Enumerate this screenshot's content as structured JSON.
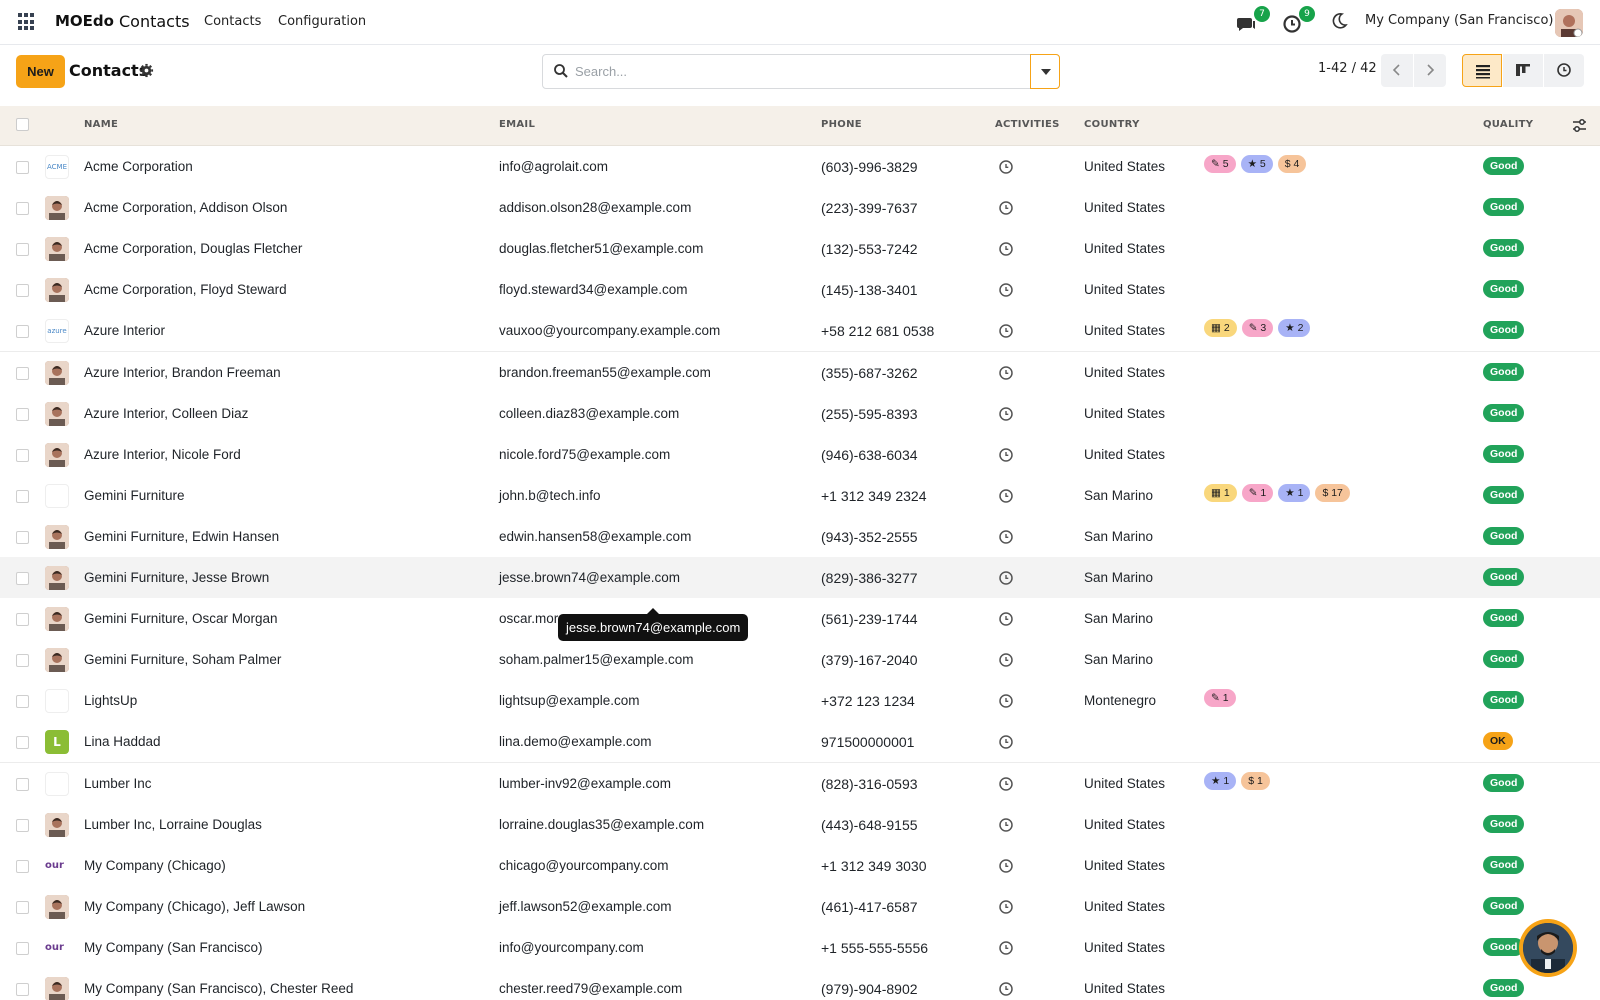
{
  "nav": {
    "brand": "MOEdo",
    "app": "Contacts",
    "menu": [
      "Contacts",
      "Configuration"
    ],
    "messages_count": "7",
    "activities_count": "9",
    "company": "My Company (San Francisco)"
  },
  "control": {
    "new_label": "New",
    "breadcrumb": "Contacts",
    "search_placeholder": "Search...",
    "pager": "1-42 / 42"
  },
  "columns": {
    "name": "NAME",
    "email": "EMAIL",
    "phone": "PHONE",
    "activities": "ACTIVITIES",
    "country": "COUNTRY",
    "quality": "QUALITY"
  },
  "rows": [
    {
      "name": "Acme Corporation",
      "email": "info@agrolait.com",
      "phone": "(603)-996-3829",
      "country": "United States",
      "quality": "Good",
      "avatar": "logo",
      "avatar_text": "ACME",
      "tags": [
        {
          "icon": "✎",
          "count": "5",
          "color": "pink"
        },
        {
          "icon": "★",
          "count": "5",
          "color": "blue"
        },
        {
          "icon": "$",
          "count": "4",
          "color": "orange"
        }
      ]
    },
    {
      "name": "Acme Corporation, Addison Olson",
      "email": "addison.olson28@example.com",
      "phone": "(223)-399-7637",
      "country": "United States",
      "quality": "Good",
      "avatar": "person",
      "tags": []
    },
    {
      "name": "Acme Corporation, Douglas Fletcher",
      "email": "douglas.fletcher51@example.com",
      "phone": "(132)-553-7242",
      "country": "United States",
      "quality": "Good",
      "avatar": "person",
      "tags": []
    },
    {
      "name": "Acme Corporation, Floyd Steward",
      "email": "floyd.steward34@example.com",
      "phone": "(145)-138-3401",
      "country": "United States",
      "quality": "Good",
      "avatar": "person",
      "tags": []
    },
    {
      "name": "Azure Interior",
      "email": "vauxoo@yourcompany.example.com",
      "phone": "+58 212 681 0538",
      "country": "United States",
      "quality": "Good",
      "avatar": "logo",
      "avatar_text": "azure",
      "tags": [
        {
          "icon": "▦",
          "count": "2",
          "color": "yellow"
        },
        {
          "icon": "✎",
          "count": "3",
          "color": "pink"
        },
        {
          "icon": "★",
          "count": "2",
          "color": "blue"
        }
      ]
    },
    {
      "name": "Azure Interior, Brandon Freeman",
      "email": "brandon.freeman55@example.com",
      "phone": "(355)-687-3262",
      "country": "United States",
      "quality": "Good",
      "avatar": "person",
      "tags": []
    },
    {
      "name": "Azure Interior, Colleen Diaz",
      "email": "colleen.diaz83@example.com",
      "phone": "(255)-595-8393",
      "country": "United States",
      "quality": "Good",
      "avatar": "person",
      "tags": []
    },
    {
      "name": "Azure Interior, Nicole Ford",
      "email": "nicole.ford75@example.com",
      "phone": "(946)-638-6034",
      "country": "United States",
      "quality": "Good",
      "avatar": "person",
      "tags": []
    },
    {
      "name": "Gemini Furniture",
      "email": "john.b@tech.info",
      "phone": "+1 312 349 2324",
      "country": "San Marino",
      "quality": "Good",
      "avatar": "logo",
      "avatar_text": "",
      "tags": [
        {
          "icon": "▦",
          "count": "1",
          "color": "yellow"
        },
        {
          "icon": "✎",
          "count": "1",
          "color": "pink"
        },
        {
          "icon": "★",
          "count": "1",
          "color": "blue"
        },
        {
          "icon": "$",
          "count": "17",
          "color": "orange"
        }
      ]
    },
    {
      "name": "Gemini Furniture, Edwin Hansen",
      "email": "edwin.hansen58@example.com",
      "phone": "(943)-352-2555",
      "country": "San Marino",
      "quality": "Good",
      "avatar": "person",
      "tags": []
    },
    {
      "name": "Gemini Furniture, Jesse Brown",
      "email": "jesse.brown74@example.com",
      "phone": "(829)-386-3277",
      "country": "San Marino",
      "quality": "Good",
      "avatar": "person",
      "tags": [],
      "hover": true
    },
    {
      "name": "Gemini Furniture, Oscar Morgan",
      "email": "oscar.mor",
      "phone": "(561)-239-1744",
      "country": "San Marino",
      "quality": "Good",
      "avatar": "person",
      "tags": []
    },
    {
      "name": "Gemini Furniture, Soham Palmer",
      "email": "soham.palmer15@example.com",
      "phone": "(379)-167-2040",
      "country": "San Marino",
      "quality": "Good",
      "avatar": "person",
      "tags": []
    },
    {
      "name": "LightsUp",
      "email": "lightsup@example.com",
      "phone": "+372 123 1234",
      "country": "Montenegro",
      "quality": "Good",
      "avatar": "logo",
      "avatar_text": "",
      "tags": [
        {
          "icon": "✎",
          "count": "1",
          "color": "pink"
        }
      ]
    },
    {
      "name": "Lina Haddad",
      "email": "lina.demo@example.com",
      "phone": "971500000001",
      "country": "",
      "quality": "OK",
      "avatar": "letter",
      "avatar_text": "L",
      "tags": []
    },
    {
      "name": "Lumber Inc",
      "email": "lumber-inv92@example.com",
      "phone": "(828)-316-0593",
      "country": "United States",
      "quality": "Good",
      "avatar": "logo",
      "avatar_text": "",
      "tags": [
        {
          "icon": "★",
          "count": "1",
          "color": "blue"
        },
        {
          "icon": "$",
          "count": "1",
          "color": "orange"
        }
      ]
    },
    {
      "name": "Lumber Inc, Lorraine Douglas",
      "email": "lorraine.douglas35@example.com",
      "phone": "(443)-648-9155",
      "country": "United States",
      "quality": "Good",
      "avatar": "person",
      "tags": []
    },
    {
      "name": "My Company (Chicago)",
      "email": "chicago@yourcompany.com",
      "phone": "+1 312 349 3030",
      "country": "United States",
      "quality": "Good",
      "avatar": "ourco",
      "avatar_text": "our",
      "tags": []
    },
    {
      "name": "My Company (Chicago), Jeff Lawson",
      "email": "jeff.lawson52@example.com",
      "phone": "(461)-417-6587",
      "country": "United States",
      "quality": "Good",
      "avatar": "person",
      "tags": []
    },
    {
      "name": "My Company (San Francisco)",
      "email": "info@yourcompany.com",
      "phone": "+1 555-555-5556",
      "country": "United States",
      "quality": "Good",
      "avatar": "ourco",
      "avatar_text": "our",
      "tags": []
    },
    {
      "name": "My Company (San Francisco), Chester Reed",
      "email": "chester.reed79@example.com",
      "phone": "(979)-904-8902",
      "country": "United States",
      "quality": "Good",
      "avatar": "person",
      "tags": []
    }
  ],
  "tooltip": "jesse.brown74@example.com",
  "colors": {
    "accent": "#f6a317",
    "header_bg": "#f5f0e9",
    "good": "#21a35a"
  }
}
